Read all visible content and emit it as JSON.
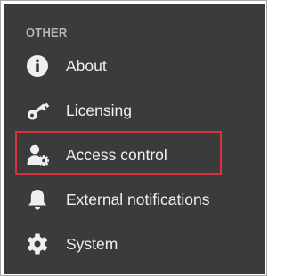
{
  "sidebar": {
    "section_title": "OTHER",
    "items": [
      {
        "label": "About",
        "icon": "info-icon"
      },
      {
        "label": "Licensing",
        "icon": "key-icon"
      },
      {
        "label": "Access control",
        "icon": "user-gear-icon",
        "highlighted": true
      },
      {
        "label": "External notifications",
        "icon": "bell-icon"
      },
      {
        "label": "System",
        "icon": "gear-icon"
      }
    ]
  },
  "colors": {
    "panel_background": "#3b3b3b",
    "text": "#f0f0f0",
    "section_title": "#b5b5b5",
    "highlight_border": "#d9323f"
  }
}
